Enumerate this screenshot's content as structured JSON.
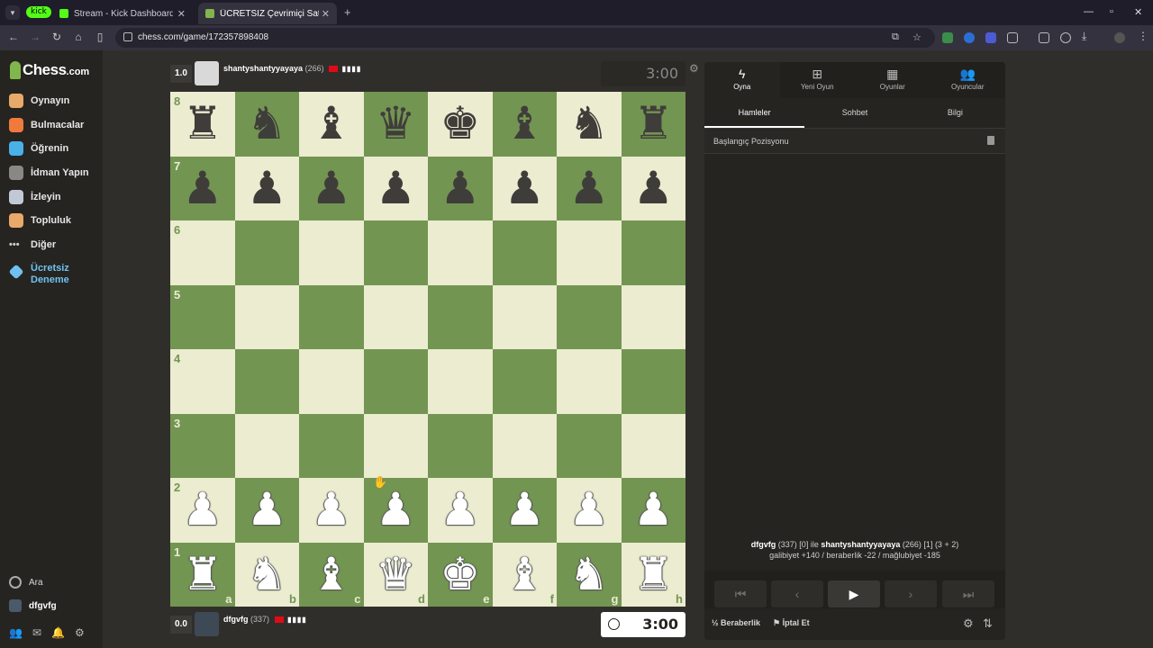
{
  "browser": {
    "tab_menu_icon": "chevron-down-icon",
    "badge": "kick",
    "tabs": [
      {
        "title": "Stream - Kick Dashboard",
        "favicon_color": "#53fc18"
      },
      {
        "title": "ÜCRETSİZ Çevrimiçi Satranç Oy",
        "favicon_color": "#81b64c"
      }
    ],
    "url": "chess.com/game/172357898408"
  },
  "logo": {
    "main": "Chess",
    "suffix": ".com"
  },
  "sidebar": {
    "items": [
      {
        "label": "Oynayın",
        "color": "#e8a96a"
      },
      {
        "label": "Bulmacalar",
        "color": "#f07a3c"
      },
      {
        "label": "Öğrenin",
        "color": "#4ab0e8"
      },
      {
        "label": "İdman Yapın",
        "color": "#8a8885"
      },
      {
        "label": "İzleyin",
        "color": "#c2c9d6"
      },
      {
        "label": "Topluluk",
        "color": "#e8a96a"
      },
      {
        "label": "Diğer",
        "color": "#cccccc"
      }
    ],
    "trial": {
      "line1": "Ücretsiz",
      "line2": "Deneme",
      "color": "#6fc2f0"
    },
    "search": "Ara",
    "user": "dfgvfg"
  },
  "top_player": {
    "score": "1.0",
    "name": "shantyshantyyayaya",
    "rating": "(266)",
    "clock": "3:00"
  },
  "bottom_player": {
    "score": "0.0",
    "name": "dfgvfg",
    "rating": "(337)",
    "clock": "3:00"
  },
  "board": {
    "ranks": [
      "8",
      "7",
      "6",
      "5",
      "4",
      "3",
      "2",
      "1"
    ],
    "files": [
      "a",
      "b",
      "c",
      "d",
      "e",
      "f",
      "g",
      "h"
    ],
    "rows": [
      [
        "bR",
        "bN",
        "bB",
        "bQ",
        "bK",
        "bB",
        "bN",
        "bR"
      ],
      [
        "bP",
        "bP",
        "bP",
        "bP",
        "bP",
        "bP",
        "bP",
        "bP"
      ],
      [
        "",
        "",
        "",
        "",
        "",
        "",
        "",
        ""
      ],
      [
        "",
        "",
        "",
        "",
        "",
        "",
        "",
        ""
      ],
      [
        "",
        "",
        "",
        "",
        "",
        "",
        "",
        ""
      ],
      [
        "",
        "",
        "",
        "",
        "",
        "",
        "",
        ""
      ],
      [
        "wP",
        "wP",
        "wP",
        "wP",
        "wP",
        "wP",
        "wP",
        "wP"
      ],
      [
        "wR",
        "wN",
        "wB",
        "wQ",
        "wK",
        "wB",
        "wN",
        "wR"
      ]
    ],
    "colors": {
      "light": "#ebecd0",
      "dark": "#739552"
    }
  },
  "panel": {
    "tabs": [
      {
        "label": "Oyna",
        "icon": "bolt-icon"
      },
      {
        "label": "Yeni Oyun",
        "icon": "plus-icon"
      },
      {
        "label": "Oyunlar",
        "icon": "board-icon"
      },
      {
        "label": "Oyuncular",
        "icon": "players-icon"
      }
    ],
    "subtabs": [
      "Hamleler",
      "Sohbet",
      "Bilgi"
    ],
    "start_position": "Başlangıç Pozisyonu",
    "game_info": {
      "white": "dfgvfg",
      "white_rating": "(337) [0] ile",
      "black": "shantyshantyyayaya",
      "black_rating": "(266) [1] (3 + 2)",
      "outcomes": "galibiyet +140 / beraberlik -22 / mağlubiyet -185"
    },
    "draw": "Beraberlik",
    "abort": "İptal Et"
  }
}
